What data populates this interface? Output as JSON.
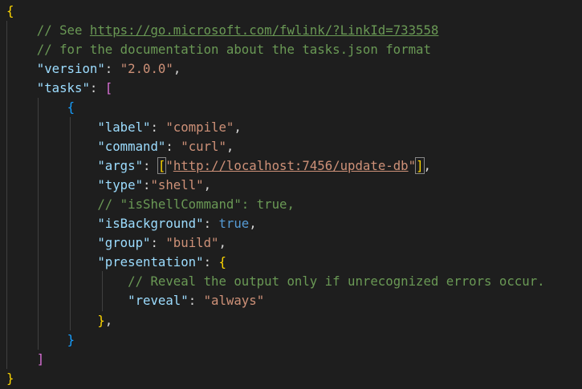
{
  "editor": {
    "lines": {
      "l01": {
        "brace_open": "{"
      },
      "l02": {
        "comment_prefix": "// See ",
        "comment_link": "https://go.microsoft.com/fwlink/?LinkId=733558"
      },
      "l03": {
        "comment": "// for the documentation about the tasks.json format"
      },
      "l04": {
        "key": "\"version\"",
        "value": "\"2.0.0\""
      },
      "l05": {
        "key": "\"tasks\"",
        "bracket": "["
      },
      "l06": {
        "brace": "{"
      },
      "l07": {
        "key": "\"label\"",
        "value": "\"compile\""
      },
      "l08": {
        "key": "\"command\"",
        "value": "\"curl\""
      },
      "l09": {
        "key": "\"args\"",
        "bracket_open": "[",
        "q_open": "\"",
        "url": "http://localhost:7456/update-db",
        "q_close": "\"",
        "bracket_close": "]"
      },
      "l10": {
        "key": "\"type\"",
        "value": "\"shell\""
      },
      "l11": {
        "comment": "// \"isShellCommand\": true,"
      },
      "l12": {
        "key": "\"isBackground\"",
        "value": "true"
      },
      "l13": {
        "key": "\"group\"",
        "value": "\"build\""
      },
      "l14": {
        "key": "\"presentation\"",
        "brace": "{"
      },
      "l15": {
        "comment": "// Reveal the output only if unrecognized errors occur."
      },
      "l16": {
        "key": "\"reveal\"",
        "value": "\"always\""
      },
      "l17": {
        "brace": "}"
      },
      "l18": {
        "brace": "}"
      },
      "l19": {
        "bracket": "]"
      },
      "l20": {
        "brace_close": "}"
      }
    }
  }
}
